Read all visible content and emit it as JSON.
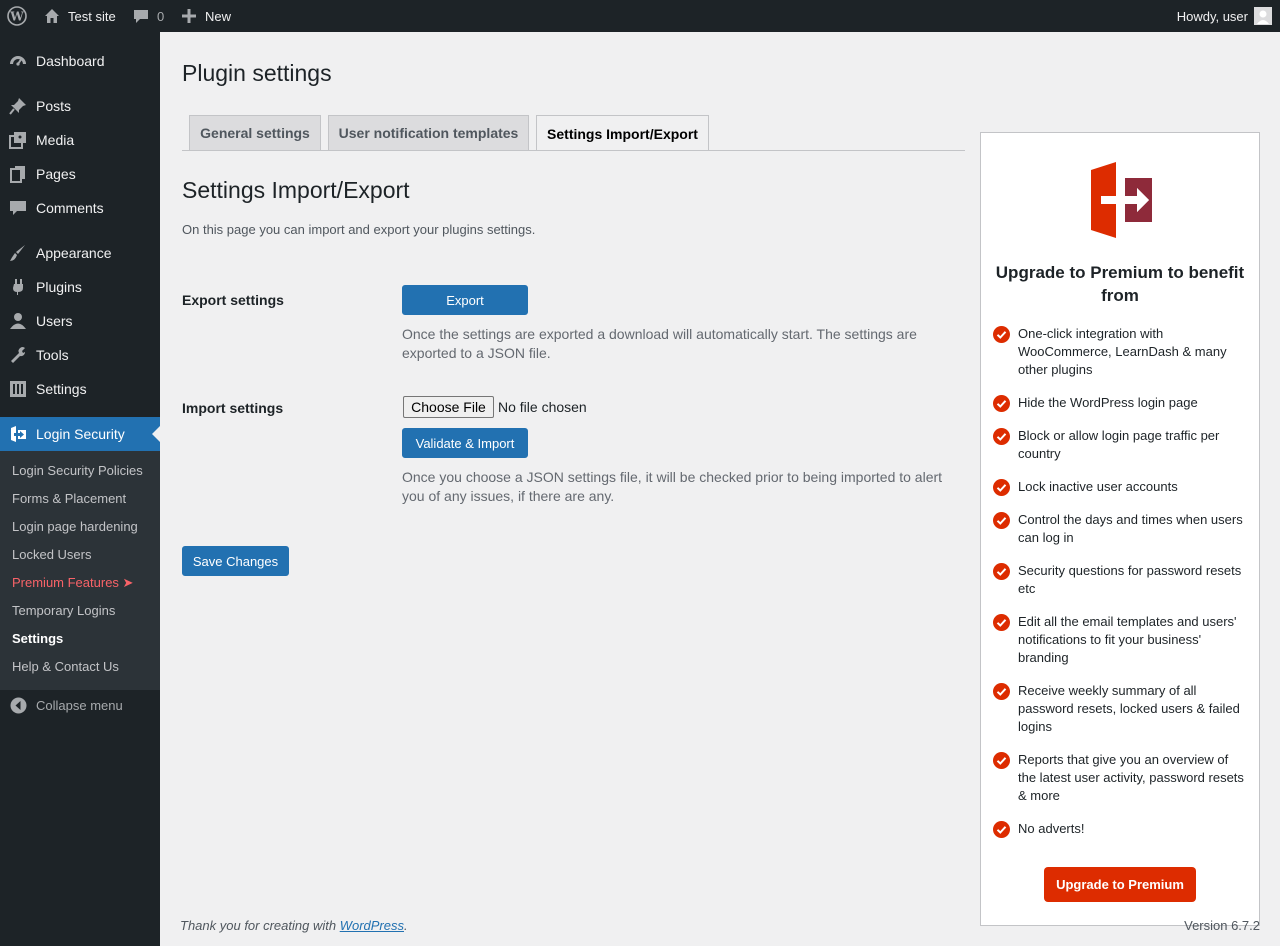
{
  "adminbar": {
    "site_name": "Test site",
    "comments_count": "0",
    "new_label": "New",
    "greeting": "Howdy, user"
  },
  "sidebar": {
    "items": [
      {
        "label": "Dashboard",
        "icon": "dashboard-icon"
      },
      {
        "label": "Posts",
        "icon": "pin-icon"
      },
      {
        "label": "Media",
        "icon": "media-icon"
      },
      {
        "label": "Pages",
        "icon": "pages-icon"
      },
      {
        "label": "Comments",
        "icon": "comment-icon"
      },
      {
        "label": "Appearance",
        "icon": "brush-icon"
      },
      {
        "label": "Plugins",
        "icon": "plugin-icon"
      },
      {
        "label": "Users",
        "icon": "user-icon"
      },
      {
        "label": "Tools",
        "icon": "wrench-icon"
      },
      {
        "label": "Settings",
        "icon": "settings-icon"
      },
      {
        "label": "Login Security",
        "icon": "login-security-icon"
      }
    ],
    "submenu": [
      "Login Security Policies",
      "Forms & Placement",
      "Login page hardening",
      "Locked Users",
      "Premium Features ➤",
      "Temporary Logins",
      "Settings",
      "Help & Contact Us"
    ],
    "collapse_label": "Collapse menu"
  },
  "main": {
    "page_title": "Plugin settings",
    "tabs": [
      {
        "label": "General settings"
      },
      {
        "label": "User notification templates"
      },
      {
        "label": "Settings Import/Export"
      }
    ],
    "section_title": "Settings Import/Export",
    "section_desc": "On this page you can import and export your plugins settings.",
    "export": {
      "label": "Export settings",
      "button": "Export",
      "help": "Once the settings are exported a download will automatically start. The settings are exported to a JSON file."
    },
    "import": {
      "label": "Import settings",
      "file_button": "Choose File",
      "file_status": "No file chosen",
      "button": "Validate & Import",
      "help": "Once you choose a JSON settings file, it will be checked prior to being imported to alert you of any issues, if there are any."
    },
    "save_button": "Save Changes"
  },
  "promo": {
    "heading": "Upgrade to Premium to benefit from",
    "features": [
      "One-click integration with WooCommerce, LearnDash & many other plugins",
      "Hide the WordPress login page",
      "Block or allow login page traffic per country",
      "Lock inactive user accounts",
      "Control the days and times when users can log in",
      "Security questions for password resets etc",
      "Edit all the email templates and users' notifications to fit your business' branding",
      "Receive weekly summary of all password resets, locked users & failed logins",
      "Reports that give you an overview of the latest user activity, password resets & more",
      "No adverts!"
    ],
    "button": "Upgrade to Premium",
    "accent_color": "#dd2c00"
  },
  "footer": {
    "text_before": "Thank you for creating with ",
    "link": "WordPress",
    "text_after": ".",
    "version": "Version 6.7.2"
  }
}
